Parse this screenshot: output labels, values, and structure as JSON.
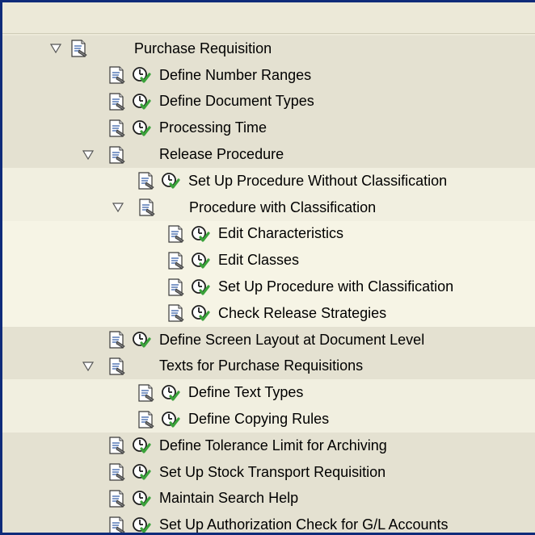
{
  "tree": {
    "root": {
      "label": "Purchase Requisition",
      "expanded": true
    },
    "items": [
      {
        "label": "Define Number Ranges",
        "level": 1,
        "type": "activity"
      },
      {
        "label": "Define Document Types",
        "level": 1,
        "type": "activity"
      },
      {
        "label": "Processing Time",
        "level": 1,
        "type": "activity"
      },
      {
        "label": "Release Procedure",
        "level": 1,
        "type": "folder",
        "expanded": true
      },
      {
        "label": "Set Up Procedure Without Classification",
        "level": 2,
        "type": "activity"
      },
      {
        "label": "Procedure with Classification",
        "level": 2,
        "type": "folder",
        "expanded": true
      },
      {
        "label": "Edit Characteristics",
        "level": 3,
        "type": "activity"
      },
      {
        "label": "Edit Classes",
        "level": 3,
        "type": "activity"
      },
      {
        "label": "Set Up Procedure with Classification",
        "level": 3,
        "type": "activity"
      },
      {
        "label": "Check Release Strategies",
        "level": 3,
        "type": "activity"
      },
      {
        "label": "Define Screen Layout at Document Level",
        "level": 1,
        "type": "activity"
      },
      {
        "label": "Texts for Purchase Requisitions",
        "level": 1,
        "type": "folder",
        "expanded": true
      },
      {
        "label": "Define Text Types",
        "level": 2,
        "type": "activity"
      },
      {
        "label": "Define Copying Rules",
        "level": 2,
        "type": "activity"
      },
      {
        "label": "Define Tolerance Limit for Archiving",
        "level": 1,
        "type": "activity"
      },
      {
        "label": "Set Up Stock Transport Requisition",
        "level": 1,
        "type": "activity"
      },
      {
        "label": "Maintain Search Help",
        "level": 1,
        "type": "activity"
      },
      {
        "label": "Set Up Authorization Check for G/L Accounts",
        "level": 1,
        "type": "activity"
      }
    ]
  },
  "icons": {
    "node": "document-icon",
    "activity": "execute-clock-icon",
    "expand": "expanded-triangle-icon"
  },
  "colors": {
    "frame": "#0f2b7a",
    "clock_check": "#3aa23a"
  }
}
